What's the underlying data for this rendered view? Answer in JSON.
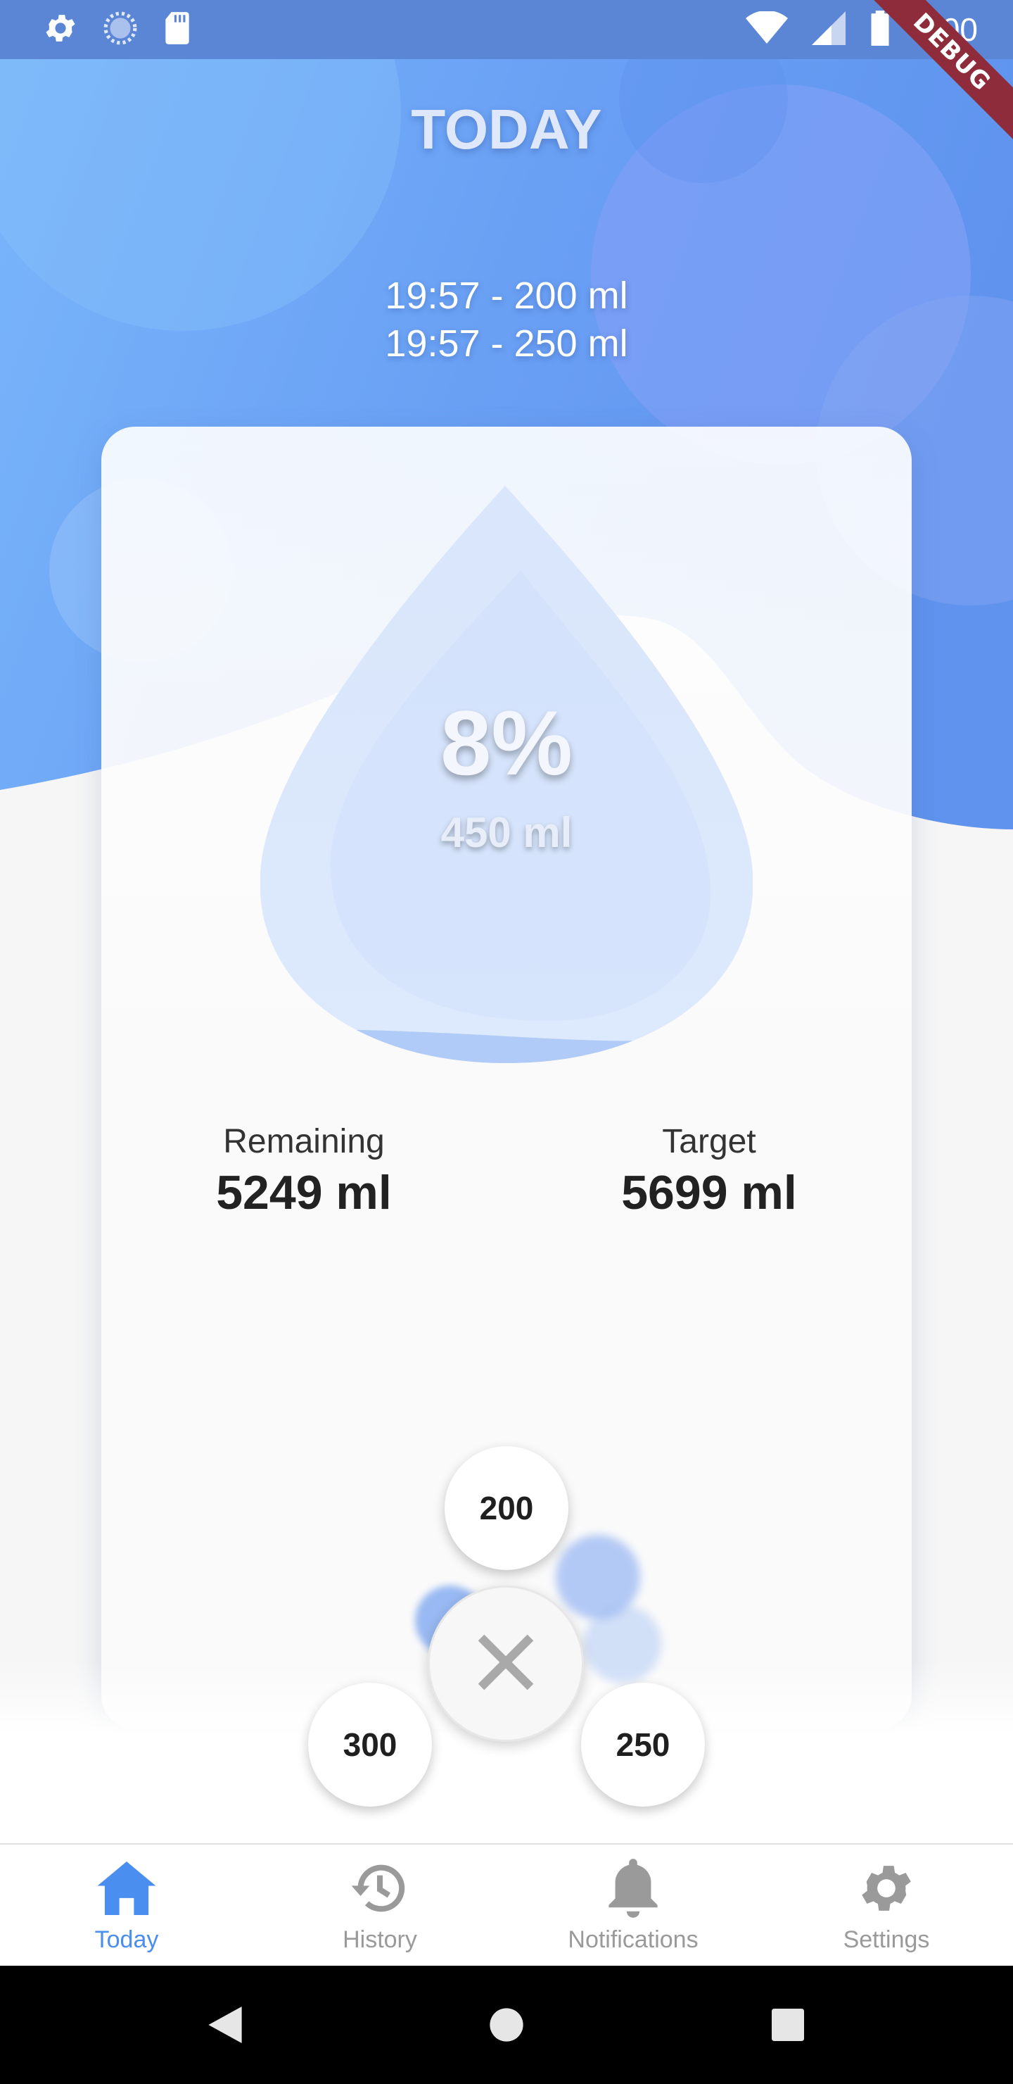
{
  "status_bar": {
    "time": "8:00",
    "left_icons": [
      "gear-icon",
      "loading-icon",
      "sd-card-icon"
    ],
    "right_icons": [
      "wifi-icon",
      "signal-icon",
      "battery-icon"
    ],
    "debug_label": "DEBUG"
  },
  "header": {
    "title": "TODAY"
  },
  "log": {
    "entries": [
      "19:57 - 200 ml",
      "19:57 - 250 ml"
    ]
  },
  "progress": {
    "percent_label": "8%",
    "amount_label": "450 ml",
    "fraction": 0.08
  },
  "stats": {
    "remaining_label": "Remaining",
    "remaining_value": "5249 ml",
    "target_label": "Target",
    "target_value": "5699 ml"
  },
  "quick_add": {
    "options": [
      "200",
      "300",
      "250"
    ],
    "close_icon": "close-icon"
  },
  "bottom_nav": {
    "items": [
      {
        "label": "Today",
        "icon": "home-icon",
        "active": true
      },
      {
        "label": "History",
        "icon": "history-icon",
        "active": false
      },
      {
        "label": "Notifications",
        "icon": "bell-icon",
        "active": false
      },
      {
        "label": "Settings",
        "icon": "settings-icon",
        "active": false
      }
    ]
  },
  "system_nav": {
    "icons": [
      "back-icon",
      "home-circle-icon",
      "recents-icon"
    ]
  },
  "colors": {
    "accent": "#4a8ef0",
    "header_blue": "#7aa9f7",
    "status_bar": "#5b86d6",
    "nav_inactive": "#9a9a9a",
    "debug_ribbon": "#8e2c3b"
  }
}
